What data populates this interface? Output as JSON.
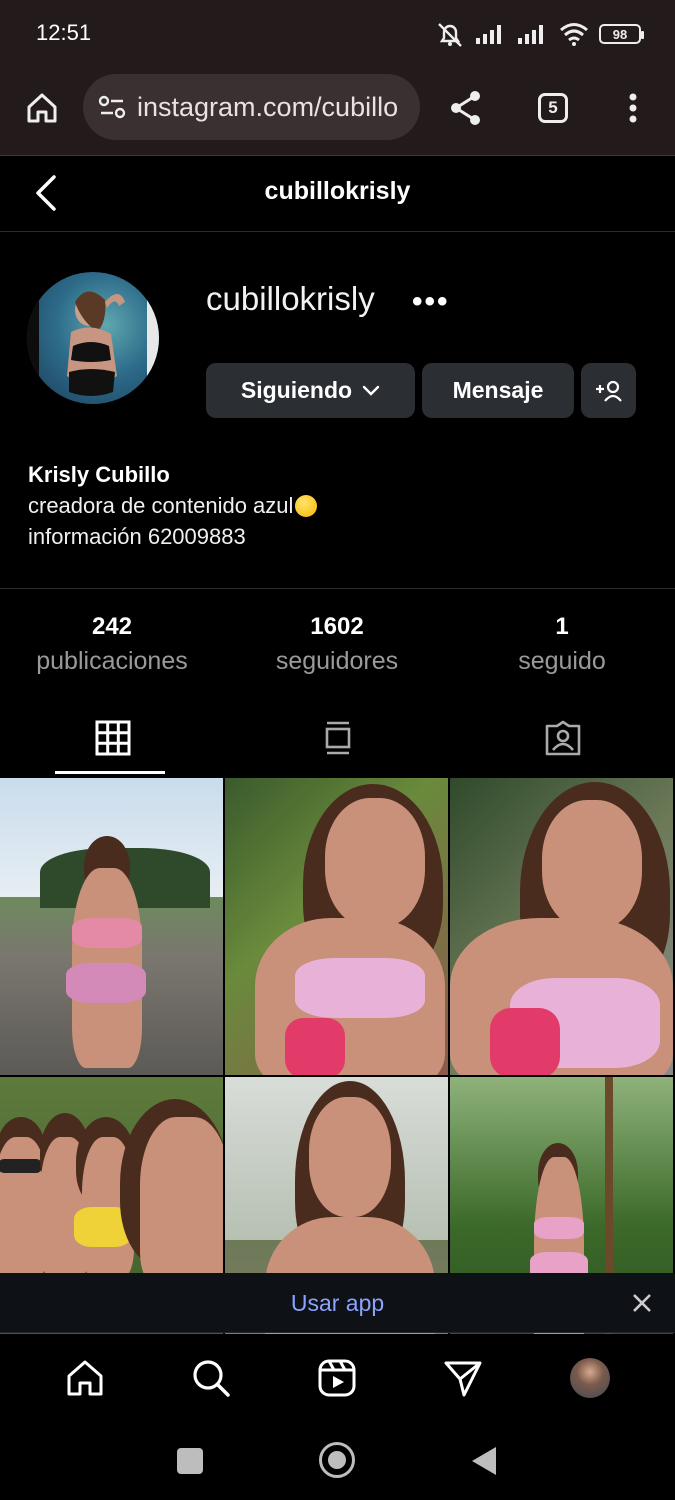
{
  "status_bar": {
    "time": "12:51",
    "battery": "98"
  },
  "browser": {
    "url": "instagram.com/cubillo",
    "tab_count": "5"
  },
  "header": {
    "title": "cubillokrisly"
  },
  "profile": {
    "username": "cubillokrisly",
    "more": "•••",
    "follow_button": "Siguiendo",
    "message_button": "Mensaje",
    "display_name": "Krisly Cubillo",
    "bio_line1": "creadora de contenido azul",
    "bio_line2": "información 62009883"
  },
  "stats": [
    {
      "number": "242",
      "label": "publicaciones"
    },
    {
      "number": "1602",
      "label": "seguidores"
    },
    {
      "number": "1",
      "label": "seguido"
    }
  ],
  "banner": {
    "label": "Usar app"
  },
  "colors": {
    "accent_link": "#8aa3ff",
    "button_bg": "#2b2e33",
    "chrome_bg": "#231a1b"
  }
}
